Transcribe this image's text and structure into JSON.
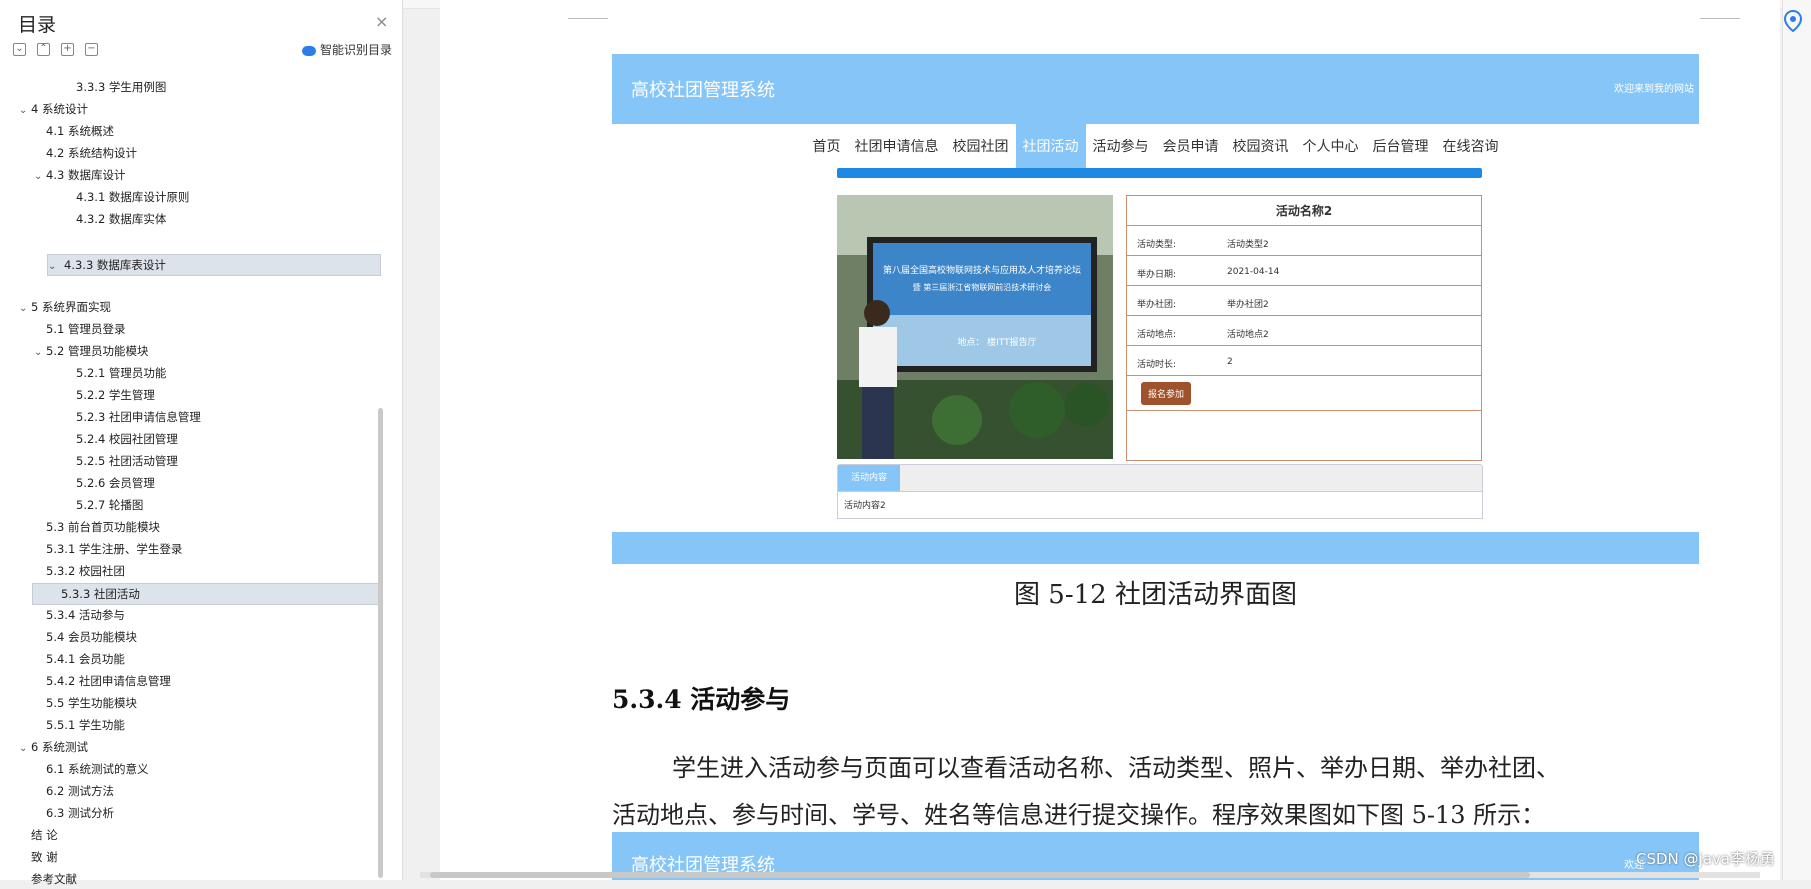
{
  "sidebar": {
    "title": "目录",
    "close": "×",
    "tools": [
      "⌄",
      "⌃",
      "+",
      "−"
    ],
    "ai_label": "智能识别目录",
    "items": [
      {
        "label": "3.3.3 学生用例图",
        "level": 3,
        "chevron": ""
      },
      {
        "label": "4  系统设计",
        "level": 1,
        "chevron": "⌄"
      },
      {
        "label": "4.1  系统概述",
        "level": 2,
        "chevron": ""
      },
      {
        "label": "4.2  系统结构设计",
        "level": 2,
        "chevron": ""
      },
      {
        "label": "4.3 数据库设计",
        "level": 2,
        "chevron": "⌄"
      },
      {
        "label": "4.3.1  数据库设计原则",
        "level": 3,
        "chevron": ""
      },
      {
        "label": "4.3.2  数据库实体",
        "level": 3,
        "chevron": ""
      },
      {
        "label": "4.3.3  数据库表设计",
        "level": 3,
        "chevron": "⌄",
        "selected": true
      },
      {
        "label": "5 系统界面实现",
        "level": 1,
        "chevron": "⌄"
      },
      {
        "label": "5.1  管理员登录",
        "level": 2,
        "chevron": ""
      },
      {
        "label": "5.2    管理员功能模块",
        "level": 2,
        "chevron": "⌄"
      },
      {
        "label": "5.2.1  管理员功能",
        "level": 3,
        "chevron": ""
      },
      {
        "label": "5.2.2 学生管理",
        "level": 3,
        "chevron": ""
      },
      {
        "label": "5.2.3  社团申请信息管理",
        "level": 3,
        "chevron": ""
      },
      {
        "label": "5.2.4 校园社团管理",
        "level": 3,
        "chevron": ""
      },
      {
        "label": "5.2.5 社团活动管理",
        "level": 3,
        "chevron": ""
      },
      {
        "label": "5.2.6 会员管理",
        "level": 3,
        "chevron": ""
      },
      {
        "label": "5.2.7 轮播图",
        "level": 3,
        "chevron": ""
      },
      {
        "label": "5.3  前台首页功能模块",
        "level": 2,
        "chevron": ""
      },
      {
        "label": "5.3.1 学生注册、学生登录",
        "level": 2,
        "chevron": ""
      },
      {
        "label": "5.3.2 校园社团",
        "level": 2,
        "chevron": ""
      },
      {
        "label": "5.3.3 社团活动",
        "level": 2,
        "chevron": "",
        "current": true
      },
      {
        "label": "5.3.4 活动参与",
        "level": 2,
        "chevron": ""
      },
      {
        "label": "5.4  会员功能模块",
        "level": 2,
        "chevron": ""
      },
      {
        "label": "5.4.1 会员功能",
        "level": 2,
        "chevron": ""
      },
      {
        "label": "5.4.2 社团申请信息管理",
        "level": 2,
        "chevron": ""
      },
      {
        "label": "5.5  学生功能模块",
        "level": 2,
        "chevron": ""
      },
      {
        "label": "5.5.1 学生功能",
        "level": 2,
        "chevron": ""
      },
      {
        "label": "6 系统测试",
        "level": 1,
        "chevron": "⌄"
      },
      {
        "label": "6.1 系统测试的意义",
        "level": 2,
        "chevron": ""
      },
      {
        "label": "6.2  测试方法",
        "level": 2,
        "chevron": ""
      },
      {
        "label": "6.3  测试分析",
        "level": 2,
        "chevron": ""
      },
      {
        "label": "结    论",
        "level": 1,
        "chevron": ""
      },
      {
        "label": "致  谢",
        "level": 1,
        "chevron": ""
      },
      {
        "label": "参考文献",
        "level": 1,
        "chevron": ""
      }
    ]
  },
  "document": {
    "app": {
      "title": "高校社团管理系统",
      "welcome": "欢迎来到我的网站",
      "nav": [
        "首页",
        "社团申请信息",
        "校园社团",
        "社团活动",
        "活动参与",
        "会员申请",
        "校园资讯",
        "个人中心",
        "后台管理",
        "在线咨询"
      ],
      "active_nav": "社团活动",
      "detail_title": "活动名称2",
      "rows": [
        {
          "label": "活动类型:",
          "value": "活动类型2"
        },
        {
          "label": "举办日期:",
          "value": "2021-04-14"
        },
        {
          "label": "举办社团:",
          "value": "举办社团2"
        },
        {
          "label": "活动地点:",
          "value": "活动地点2"
        },
        {
          "label": "活动时长:",
          "value": "2"
        }
      ],
      "signup": "报名参加",
      "content_tab": "活动内容",
      "content_text": "活动内容2",
      "banner_line1": "第八届全国高校物联网技术与应用及人才培养论坛",
      "banner_line2": "暨 第三届浙江省物联网前沿技术研讨会",
      "banner_line3": "地点：   楼ITT报告厅"
    },
    "caption": "图 5-12 社团活动界面图",
    "heading": "5.3.4 活动参与",
    "para1": "学生进入活动参与页面可以查看活动名称、活动类型、照片、举办日期、举办社团、",
    "para2": "活动地点、参与时间、学号、姓名等信息进行提交操作。程序效果图如下图 5-13 所示：",
    "app2_title": "高校社团管理系统",
    "app2_welcome": "欢迎",
    "watermark": "CSDN @java李杨勇"
  },
  "colors": {
    "header": "#85c5f8",
    "nav_bar": "#1e88e5",
    "signup": "#a0522d",
    "border": "#c98f6f"
  }
}
